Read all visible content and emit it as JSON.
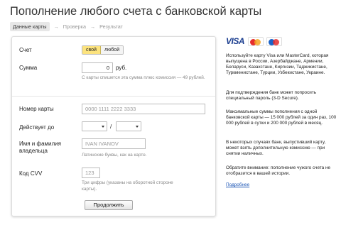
{
  "page": {
    "title": "Пополнение любого счета с банковской карты",
    "steps": [
      "Данные карты",
      "Проверка",
      "Результат"
    ],
    "arrows": [
      "→",
      "→"
    ]
  },
  "form": {
    "account": {
      "label": "Счет",
      "options": [
        "свой",
        "любой"
      ],
      "selected": "свой"
    },
    "amount": {
      "label": "Сумма",
      "value": "0",
      "currency": "руб.",
      "hint": "С карты спишется эта сумма плюс комиссия — 49 рублей."
    },
    "card_number": {
      "label": "Номер карты",
      "placeholder": "0000 1111 2222 3333"
    },
    "valid_until": {
      "label": "Действует до",
      "separator": "/"
    },
    "holder": {
      "label_line1": "Имя и фамилия",
      "label_line2": "владельца",
      "placeholder": "IVAN IVANOV",
      "hint": "Латинские буквы, как на карте."
    },
    "cvv": {
      "label": "Код CVV",
      "placeholder": "123",
      "hint_line1": "Три цифры (указаны на оборотной стороне",
      "hint_line2": "карты)."
    },
    "submit_label": "Продолжить"
  },
  "sidebar": {
    "logos": [
      "VISA",
      "MasterCard",
      "Maestro"
    ],
    "p1": "Используйте карту Visa или MasterCard, которая выпущена в России, Азербайджане, Армении, Беларуси, Казахстане, Киргизии, Таджикистане, Туркменистане, Турции, Узбекистане, Украине.",
    "p2": "Для подтверждения банк может попросить специальный пароль (3-D Secure).",
    "p3": "Максимальные суммы пополнения с одной банковской карты — 15 000 рублей за один раз, 100 000 рублей в сутки и 200 000 рублей в месяц.",
    "p4": "В некоторых случаях банк, выпустивший карту, может взять дополнительную комиссию — при снятии наличных.",
    "p5": "Обратите внимание: пополнение чужого счета не отобразится в вашей истории.",
    "link": "Подробнее"
  }
}
